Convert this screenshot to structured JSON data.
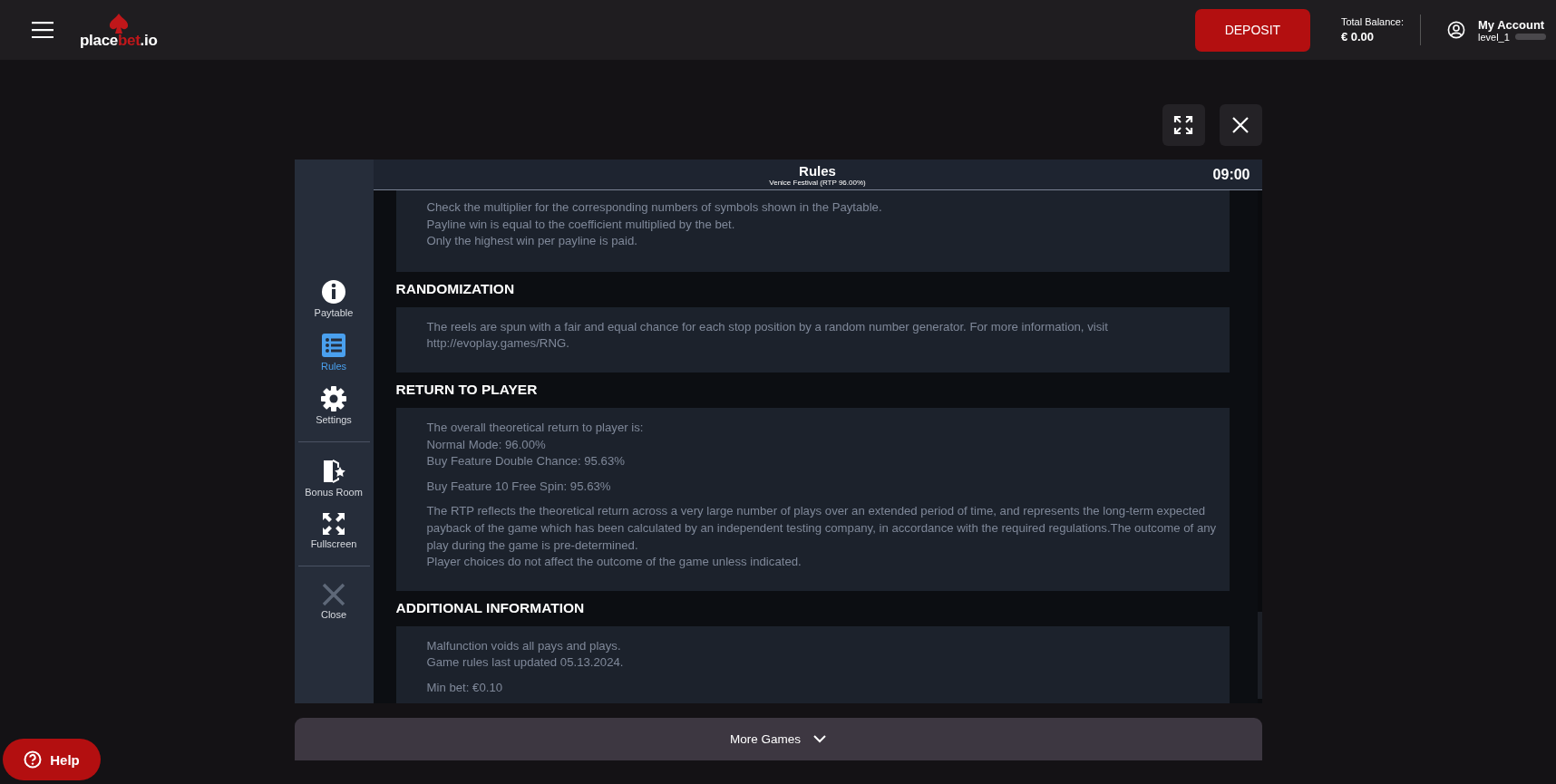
{
  "header": {
    "logo": [
      {
        "text": "place",
        "accent": false
      },
      {
        "text": "bet",
        "accent": true
      },
      {
        "text": ".io",
        "accent": false
      }
    ],
    "deposit": "DEPOSIT",
    "balance_label": "Total Balance:",
    "balance": "€ 0.00",
    "account_title": "My Account",
    "account_level": "level_1"
  },
  "game": {
    "title": "Rules",
    "subtitle": "Venice Festival (RTP 96.00%)",
    "time": "09:00",
    "sidebar": [
      [
        {
          "kind": "info",
          "label": "Paytable",
          "selected": false
        },
        {
          "kind": "list",
          "label": "Rules",
          "selected": true
        },
        {
          "kind": "gear",
          "label": "Settings",
          "selected": false
        }
      ],
      [
        {
          "kind": "door",
          "label": "Bonus Room",
          "selected": false
        },
        {
          "kind": "expand",
          "label": "Fullscreen",
          "selected": false
        }
      ],
      [
        {
          "kind": "close",
          "label": "Close",
          "selected": false
        }
      ]
    ],
    "sections": [
      {
        "paragraphs": [
          [
            "Check the multiplier for the corresponding numbers of symbols shown in the Paytable.",
            "Payline win is equal to the coefficient multiplied by the bet.",
            "Only the highest win per payline is paid."
          ]
        ]
      },
      {
        "heading": "RANDOMIZATION",
        "paragraphs": [
          [
            "The reels are spun with a fair and equal chance for each stop position by a random number generator. For more information, visit http://evoplay.games/RNG."
          ]
        ]
      },
      {
        "heading": "RETURN TO PLAYER",
        "paragraphs": [
          [
            "The overall theoretical return to player is:",
            "Normal Mode: 96.00%",
            "Buy Feature Double Chance: 95.63%"
          ],
          [
            "Buy Feature 10 Free Spin: 95.63%"
          ],
          [
            "The RTP reflects the theoretical return across a very large number of plays over an extended period of time, and represents the long-term expected payback of the game which has been calculated by an independent testing company, in accordance with the required regulations.The outcome of any play during the game is pre-determined.",
            "Player choices do not affect the outcome of the game unless indicated."
          ]
        ]
      },
      {
        "heading": "ADDITIONAL INFORMATION",
        "paragraphs": [
          [
            "Malfunction voids all pays and plays.",
            "Game rules last updated 05.13.2024."
          ],
          [
            "Min bet: €0.10"
          ]
        ]
      }
    ]
  },
  "more_games": "More Games",
  "help": "Help"
}
